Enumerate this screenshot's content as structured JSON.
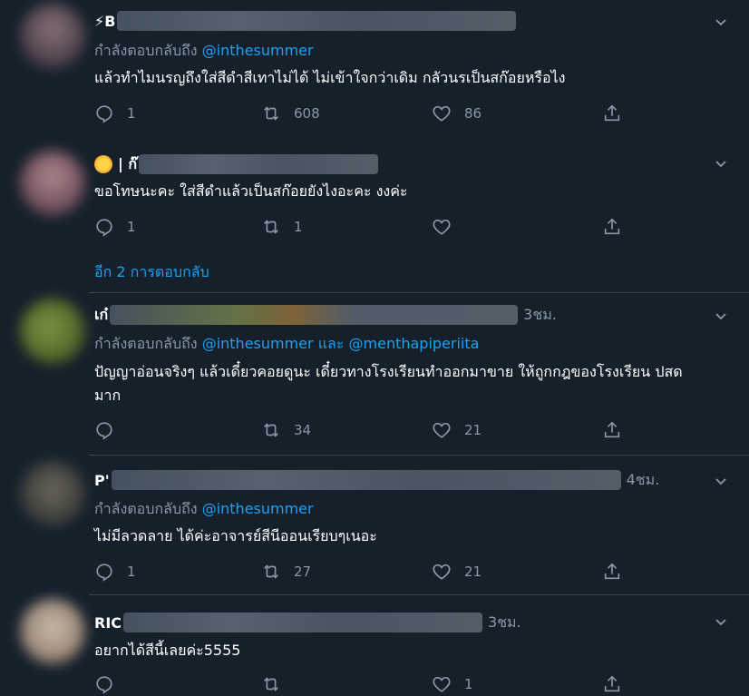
{
  "tweets": [
    {
      "name": "⚡B",
      "time": "",
      "reply_prefix": "กำลังตอบกลับถึง",
      "mentions": [
        "@inthesummer"
      ],
      "text": "แล้วทำไมนรญถึงใส่สีดำสีเทาไม่ได้ ไม่เข้าใจกว่าเดิม กลัวนรเป็นสก๊อยหรือไง",
      "replies": "1",
      "retweets": "608",
      "likes": "86"
    },
    {
      "name": "| ก๊",
      "time": "",
      "reply_prefix": "",
      "mentions": [],
      "text": "ขอโทษนะคะ ใส่สีดำแล้วเป็นสก๊อยยังไงอะคะ งงค่ะ",
      "replies": "1",
      "retweets": "1",
      "likes": ""
    },
    {
      "name": "เก๋",
      "time": "3ชม.",
      "reply_prefix": "กำลังตอบกลับถึง",
      "mentions": [
        "@inthesummer",
        "@menthapiperiita"
      ],
      "mention_joiner": "และ",
      "text": "ปัญญาอ่อนจริงๆ แล้วเดี๋ยวคอยดูนะ เดี๋ยวทางโรงเรียนทำออกมาขาย ให้ถูกกฎของโรงเรียน ปสด มาก",
      "replies": "",
      "retweets": "34",
      "likes": "21"
    },
    {
      "name": "P'",
      "time": "4ชม.",
      "reply_prefix": "กำลังตอบกลับถึง",
      "mentions": [
        "@inthesummer"
      ],
      "text": "ไม่มีลวดลาย ได้ค่ะอาจารย์สีนีออนเรียบๆเนอะ",
      "replies": "1",
      "retweets": "27",
      "likes": "21"
    },
    {
      "name": "RIC",
      "time": "3ชม.",
      "reply_prefix": "",
      "mentions": [],
      "text": "อยากได้สีนี้เลยค่ะ5555",
      "replies": "",
      "retweets": "",
      "likes": "1"
    }
  ],
  "more_replies": "อีก 2 การตอบกลับ",
  "colors": {
    "background": "#15202b",
    "secondary_text": "#8899a6",
    "link": "#1da1f2",
    "divider": "#38444d"
  },
  "icons": [
    "reply-icon",
    "retweet-icon",
    "like-icon",
    "share-icon",
    "chevron-down-icon",
    "sun-emoji"
  ]
}
